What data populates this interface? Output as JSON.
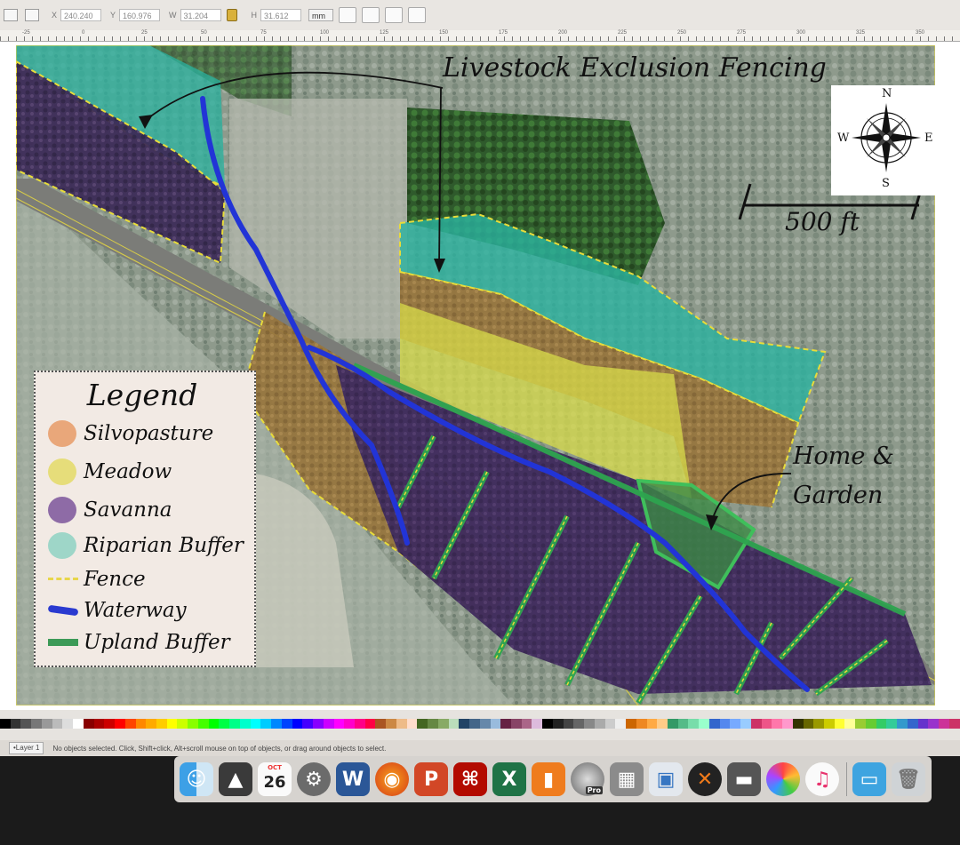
{
  "toolbar": {
    "x_label": "X",
    "x_value": "240.240",
    "y_label": "Y",
    "y_value": "160.976",
    "w_label": "W",
    "w_value": "31.204",
    "h_label": "H",
    "h_value": "31.612",
    "unit": "mm"
  },
  "ruler": {
    "labels": [
      "-25",
      "0",
      "25",
      "50",
      "75",
      "100",
      "125",
      "150",
      "175",
      "200",
      "225",
      "250",
      "275",
      "300",
      "325",
      "350"
    ]
  },
  "map": {
    "title_annotation": "Livestock Exclusion Fencing",
    "scale_label": "500 ft",
    "home_label_line1": "Home &",
    "home_label_line2": "Garden",
    "compass": {
      "n": "N",
      "s": "S",
      "e": "E",
      "w": "W"
    },
    "zone_colors": {
      "silvopasture": "#c9843f",
      "meadow": "#d8dc49",
      "savanna": "#4a2f6b",
      "riparian_buffer": "#27b6a3",
      "upland_buffer": "#2ea44f",
      "waterway": "#2234d6",
      "fence": "#f3e03a"
    }
  },
  "legend": {
    "title": "Legend",
    "items": [
      {
        "label": "Silvopasture",
        "color": "#e9a77a"
      },
      {
        "label": "Meadow",
        "color": "#e6dd7a"
      },
      {
        "label": "Savanna",
        "color": "#8e6ba6"
      },
      {
        "label": "Riparian Buffer",
        "color": "#9ed6c8"
      },
      {
        "label": "Fence",
        "color": "#e8d64a"
      },
      {
        "label": "Waterway",
        "color": "#2a3ad0"
      },
      {
        "label": "Upland Buffer",
        "color": "#3c9a57"
      }
    ]
  },
  "status": {
    "layer": "•Layer 1",
    "message": "No objects selected. Click, Shift+click, Alt+scroll mouse on top of objects, or drag around objects to select."
  },
  "dock": {
    "calendar_month": "OCT",
    "calendar_day": "26",
    "items": [
      "finder-icon",
      "inkscape-icon",
      "calendar-icon",
      "system-preferences-icon",
      "word-icon",
      "firefox-icon",
      "powerpoint-icon",
      "acrobat-icon",
      "excel-icon",
      "ibooks-icon",
      "google-earth-pro-icon",
      "calculator-icon",
      "preview-icon",
      "xquartz-icon",
      "scanner-icon",
      "photos-icon",
      "itunes-icon",
      "downloads-folder-icon",
      "trash-icon"
    ]
  }
}
